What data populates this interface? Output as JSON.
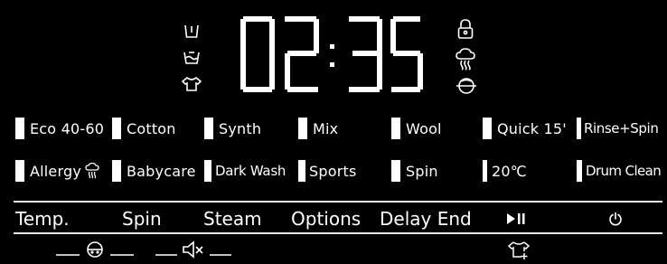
{
  "display": {
    "time": {
      "d1": "0",
      "d2": "2",
      "separator": ":",
      "d3": "3",
      "d4": "5"
    },
    "left_icons": [
      "prewash-tub-icon",
      "main-wash-tub-icon",
      "shirt-iron-icon"
    ],
    "right_icons": [
      "child-lock-icon",
      "steam-cloud-icon",
      "drum-rinse-icon"
    ]
  },
  "programs": {
    "row1": [
      {
        "label": "Eco 40-60"
      },
      {
        "label": "Cotton"
      },
      {
        "label": "Synth"
      },
      {
        "label": "Mix"
      },
      {
        "label": "Wool"
      },
      {
        "label": "Quick 15'"
      },
      {
        "label": "Rinse+Spin"
      }
    ],
    "row2": [
      {
        "label": "Allergy"
      },
      {
        "label": "Babycare"
      },
      {
        "label": "Dark Wash"
      },
      {
        "label": "Sports"
      },
      {
        "label": "Spin"
      },
      {
        "label": "20℃"
      },
      {
        "label": "Drum Clean"
      }
    ]
  },
  "functions": {
    "temp": "Temp.",
    "spin": "Spin",
    "steam": "Steam",
    "options": "Options",
    "delay_end": "Delay End",
    "start_pause_icon": "play-pause-icon",
    "power_icon": "power-icon"
  },
  "bottom_icons": [
    "child-lock-face-icon",
    "mute-speaker-icon",
    "shirt-plus-icon"
  ],
  "colors": {
    "background": "#000000",
    "foreground": "#ffffff"
  }
}
